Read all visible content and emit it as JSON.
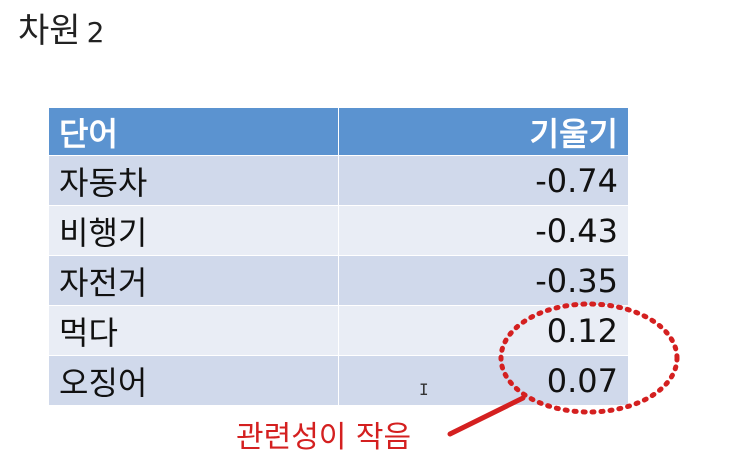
{
  "title": {
    "text": "차원",
    "number": "2"
  },
  "table": {
    "headers": {
      "word": "단어",
      "slope": "기울기"
    },
    "rows": [
      {
        "word": "자동차",
        "slope": "-0.74"
      },
      {
        "word": "비행기",
        "slope": "-0.43"
      },
      {
        "word": "자전거",
        "slope": "-0.35"
      },
      {
        "word": "먹다",
        "slope": "0.12"
      },
      {
        "word": "오징어",
        "slope": "0.07"
      }
    ]
  },
  "annotation": {
    "label": "관련성이 작음",
    "color": "#d42020"
  },
  "colors": {
    "header_bg": "#5b93d0",
    "row_odd_bg": "#d0d9eb",
    "row_even_bg": "#e9edf5"
  },
  "cursor_icon": "text-cursor-icon"
}
